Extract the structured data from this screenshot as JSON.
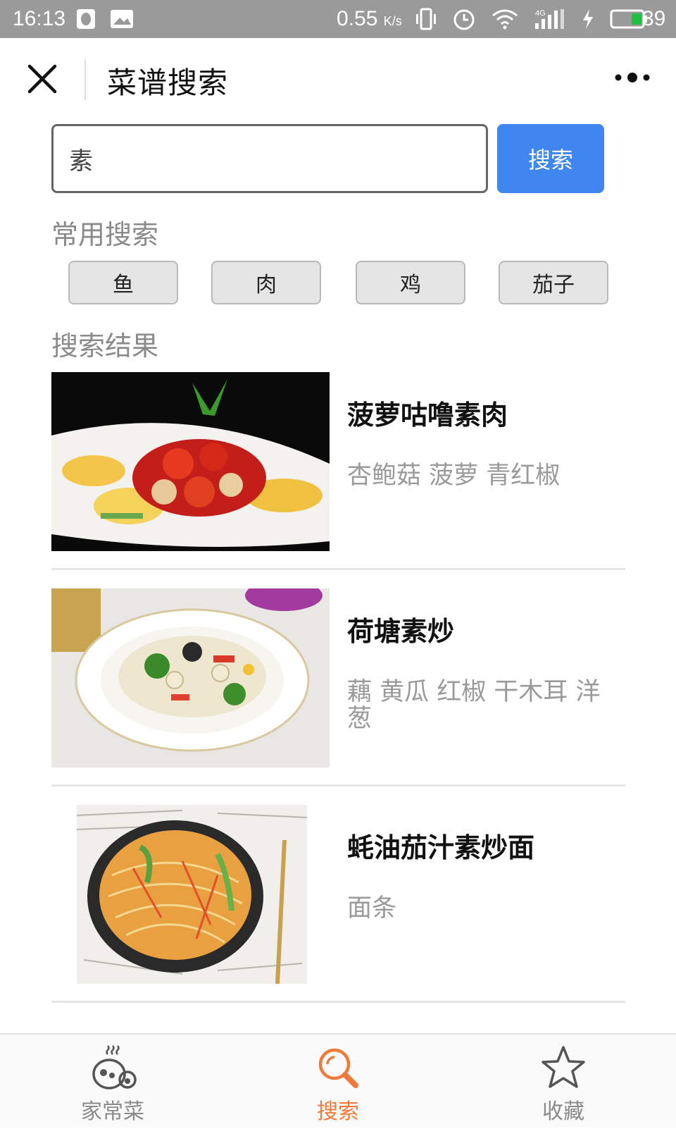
{
  "status_bar": {
    "time": "16:13",
    "net_speed": "0.55",
    "net_unit": "K/s",
    "signal_label": "4G",
    "battery": "39"
  },
  "header": {
    "title": "菜谱搜索"
  },
  "search": {
    "value": "素",
    "button_label": "搜索"
  },
  "common": {
    "label": "常用搜索",
    "chips": [
      "鱼",
      "肉",
      "鸡",
      "茄子"
    ]
  },
  "results": {
    "label": "搜索结果",
    "items": [
      {
        "title": "菠萝咕噜素肉",
        "ingredients": "杏鲍菇 菠萝 青红椒"
      },
      {
        "title": "荷塘素炒",
        "ingredients": "藕 黄瓜 红椒 干木耳 洋葱"
      },
      {
        "title": "蚝油茄汁素炒面",
        "ingredients": "面条"
      }
    ]
  },
  "tabbar": {
    "tabs": [
      {
        "label": "家常菜",
        "icon": "home-dish-icon"
      },
      {
        "label": "搜索",
        "icon": "search-icon",
        "active": true
      },
      {
        "label": "收藏",
        "icon": "star-icon"
      }
    ]
  },
  "colors": {
    "primary_button": "#3f86ee",
    "active_tab": "#f07a3a",
    "muted_text": "#8a8a8a"
  }
}
